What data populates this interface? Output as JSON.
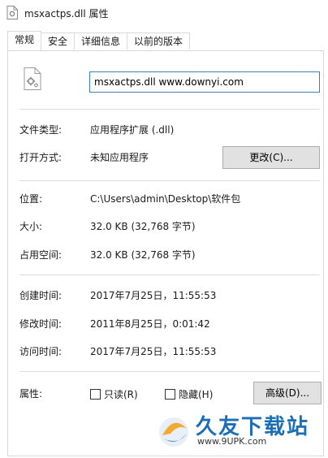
{
  "window": {
    "title": "msxactps.dll 属性"
  },
  "tabs": [
    {
      "label": "常规",
      "active": true
    },
    {
      "label": "安全",
      "active": false
    },
    {
      "label": "详细信息",
      "active": false
    },
    {
      "label": "以前的版本",
      "active": false
    }
  ],
  "general": {
    "filename": "msxactps.dll www.downyi.com",
    "file_type_label": "文件类型:",
    "file_type_value": "应用程序扩展 (.dll)",
    "open_with_label": "打开方式:",
    "open_with_value": "未知应用程序",
    "change_button": "更改(C)...",
    "location_label": "位置:",
    "location_value": "C:\\Users\\admin\\Desktop\\软件包",
    "size_label": "大小:",
    "size_value": "32.0 KB (32,768 字节)",
    "disk_size_label": "占用空间:",
    "disk_size_value": "32.0 KB (32,768 字节)",
    "created_label": "创建时间:",
    "created_value": "2017年7月25日，11:55:53",
    "modified_label": "修改时间:",
    "modified_value": "2011年8月25日，0:01:42",
    "accessed_label": "访问时间:",
    "accessed_value": "2017年7月25日，11:55:53",
    "attributes_label": "属性:",
    "readonly_label": "只读(R)",
    "readonly_checked": false,
    "hidden_label": "隐藏(H)",
    "hidden_checked": false,
    "advanced_button": "高级(D)..."
  },
  "watermark": {
    "brand": "久友下载站",
    "url": "www.9UPK.com"
  }
}
